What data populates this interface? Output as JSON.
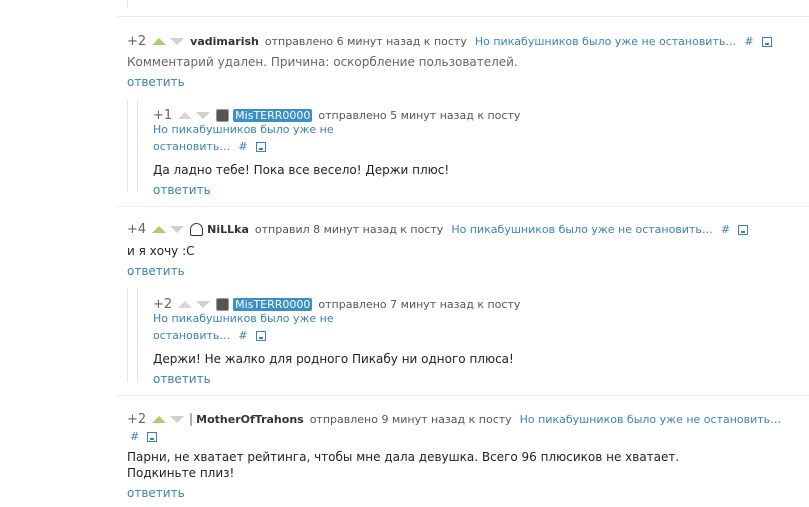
{
  "comments": [
    {
      "rating": "+2",
      "user": "vadimarish",
      "meta": "отправлено 6 минут назад к посту",
      "post_link": "Но пикабушников было уже не остановить…",
      "hash": "#",
      "text": "Комментарий удален. Причина: оскорбление пользователей.",
      "reply": "ответить"
    },
    {
      "rating": "+1",
      "user": "MisTERR0000",
      "meta": "отправлено 5 минут назад к посту",
      "post_link_1": "Но пикабушников было уже не",
      "post_link_2": "остановить…",
      "hash": "#",
      "text": "Да ладно тебе! Пока все весело! Держи плюс!",
      "reply": "ответить"
    },
    {
      "rating": "+4",
      "user": "NiLLka",
      "meta": "отправил 8 минут назад к посту",
      "post_link": "Но пикабушников было уже не остановить…",
      "hash": "#",
      "text": "и я хочу :С",
      "reply": "ответить"
    },
    {
      "rating": "+2",
      "user": "MisTERR0000",
      "meta": "отправлено 7 минут назад к посту",
      "post_link_1": "Но пикабушников было уже не",
      "post_link_2": "остановить…",
      "hash": "#",
      "text": "Держи! Не жалко для родного Пикабу ни одного плюса!",
      "reply": "ответить"
    },
    {
      "rating": "+2",
      "user": "MotherOfTrahons",
      "meta": "отправлено 9 минут назад к посту",
      "post_link": "Но пикабушников было уже не остановить…",
      "hash": "#",
      "text": "Парни, не хватает рейтинга, чтобы мне дала девушка. Всего 96 плюсиков не хватает. Подкиньте плиз!",
      "reply": "ответить"
    }
  ],
  "colors": {
    "link": "#3a82b6",
    "upvote": "#a6d16a",
    "downvote": "#d0d0d0",
    "badge": "#3a8fc7"
  }
}
